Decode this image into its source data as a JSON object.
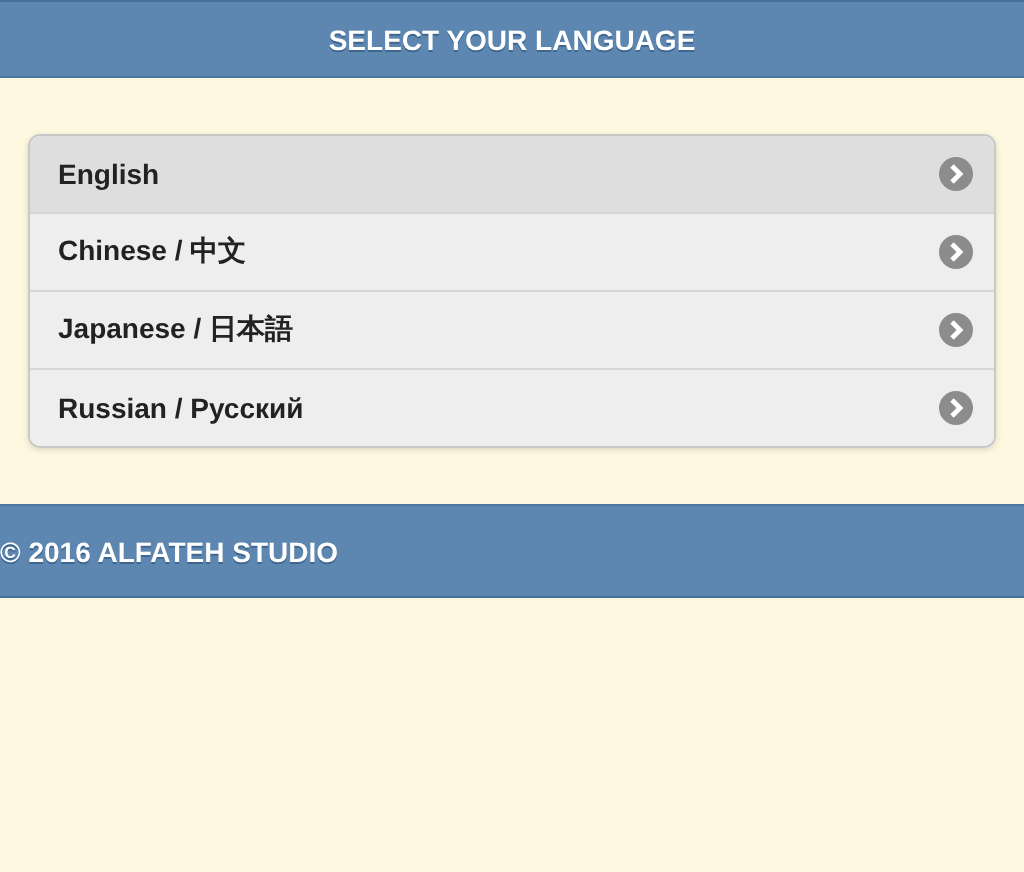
{
  "header": {
    "title": "SELECT YOUR LANGUAGE"
  },
  "languages": [
    {
      "label": "English",
      "selected": true
    },
    {
      "label": "Chinese / 中文",
      "selected": false
    },
    {
      "label": "Japanese / 日本語",
      "selected": false
    },
    {
      "label": "Russian / Русский",
      "selected": false
    }
  ],
  "footer": {
    "text": "© 2016 ALFATEH STUDIO"
  }
}
